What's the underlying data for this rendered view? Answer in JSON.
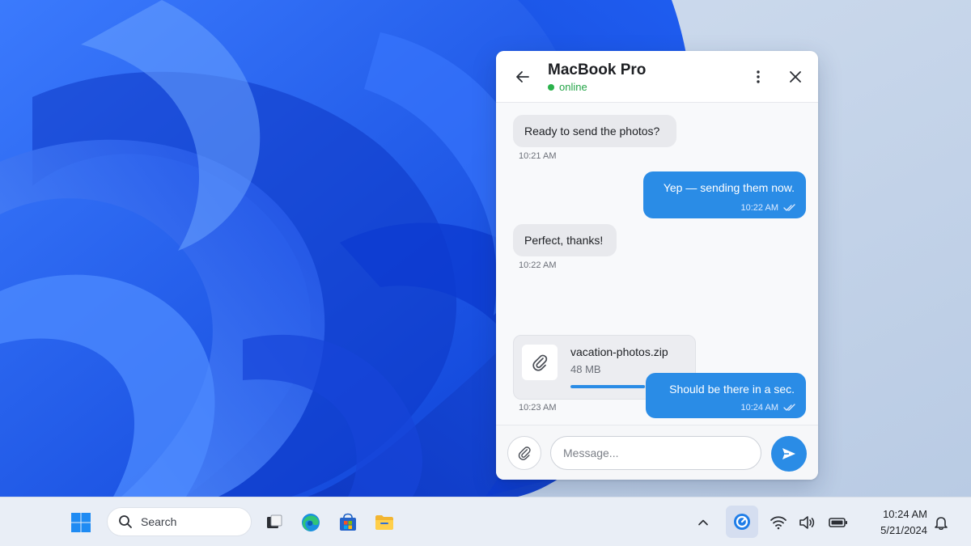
{
  "chat": {
    "title": "MacBook Pro",
    "status": "online",
    "messages": [
      {
        "direction": "in",
        "text": "Ready to send the photos?",
        "time": "10:21 AM"
      },
      {
        "direction": "out",
        "text": "Yep — sending them now.",
        "time": "10:22 AM",
        "read": true
      },
      {
        "direction": "in",
        "text": "Perfect, thanks!",
        "time": "10:22 AM"
      },
      {
        "direction": "in",
        "type": "file",
        "file_name": "vacation-photos.zip",
        "file_size": "48 MB",
        "progress_percent": 66,
        "time": "10:23 AM"
      },
      {
        "direction": "out",
        "text": "Should be there in a sec.",
        "time": "10:24 AM",
        "read": true
      }
    ],
    "composer": {
      "placeholder": "Message..."
    }
  },
  "taskbar": {
    "search_label": "Search",
    "pinned_apps": [
      "windows-start",
      "task-view",
      "edge",
      "microsoft-store",
      "file-explorer"
    ],
    "tray_icons": [
      "chevron-up",
      "app-tray-active",
      "wifi",
      "volume",
      "battery",
      "notifications"
    ],
    "clock": {
      "time": "10:24 AM",
      "date": "5/21/2024"
    }
  },
  "colors": {
    "accent": "#2a8ce6",
    "online": "#23a447",
    "wallpaper_blue": "#1f5df0",
    "wallpaper_bg": "#c4d3e8"
  }
}
